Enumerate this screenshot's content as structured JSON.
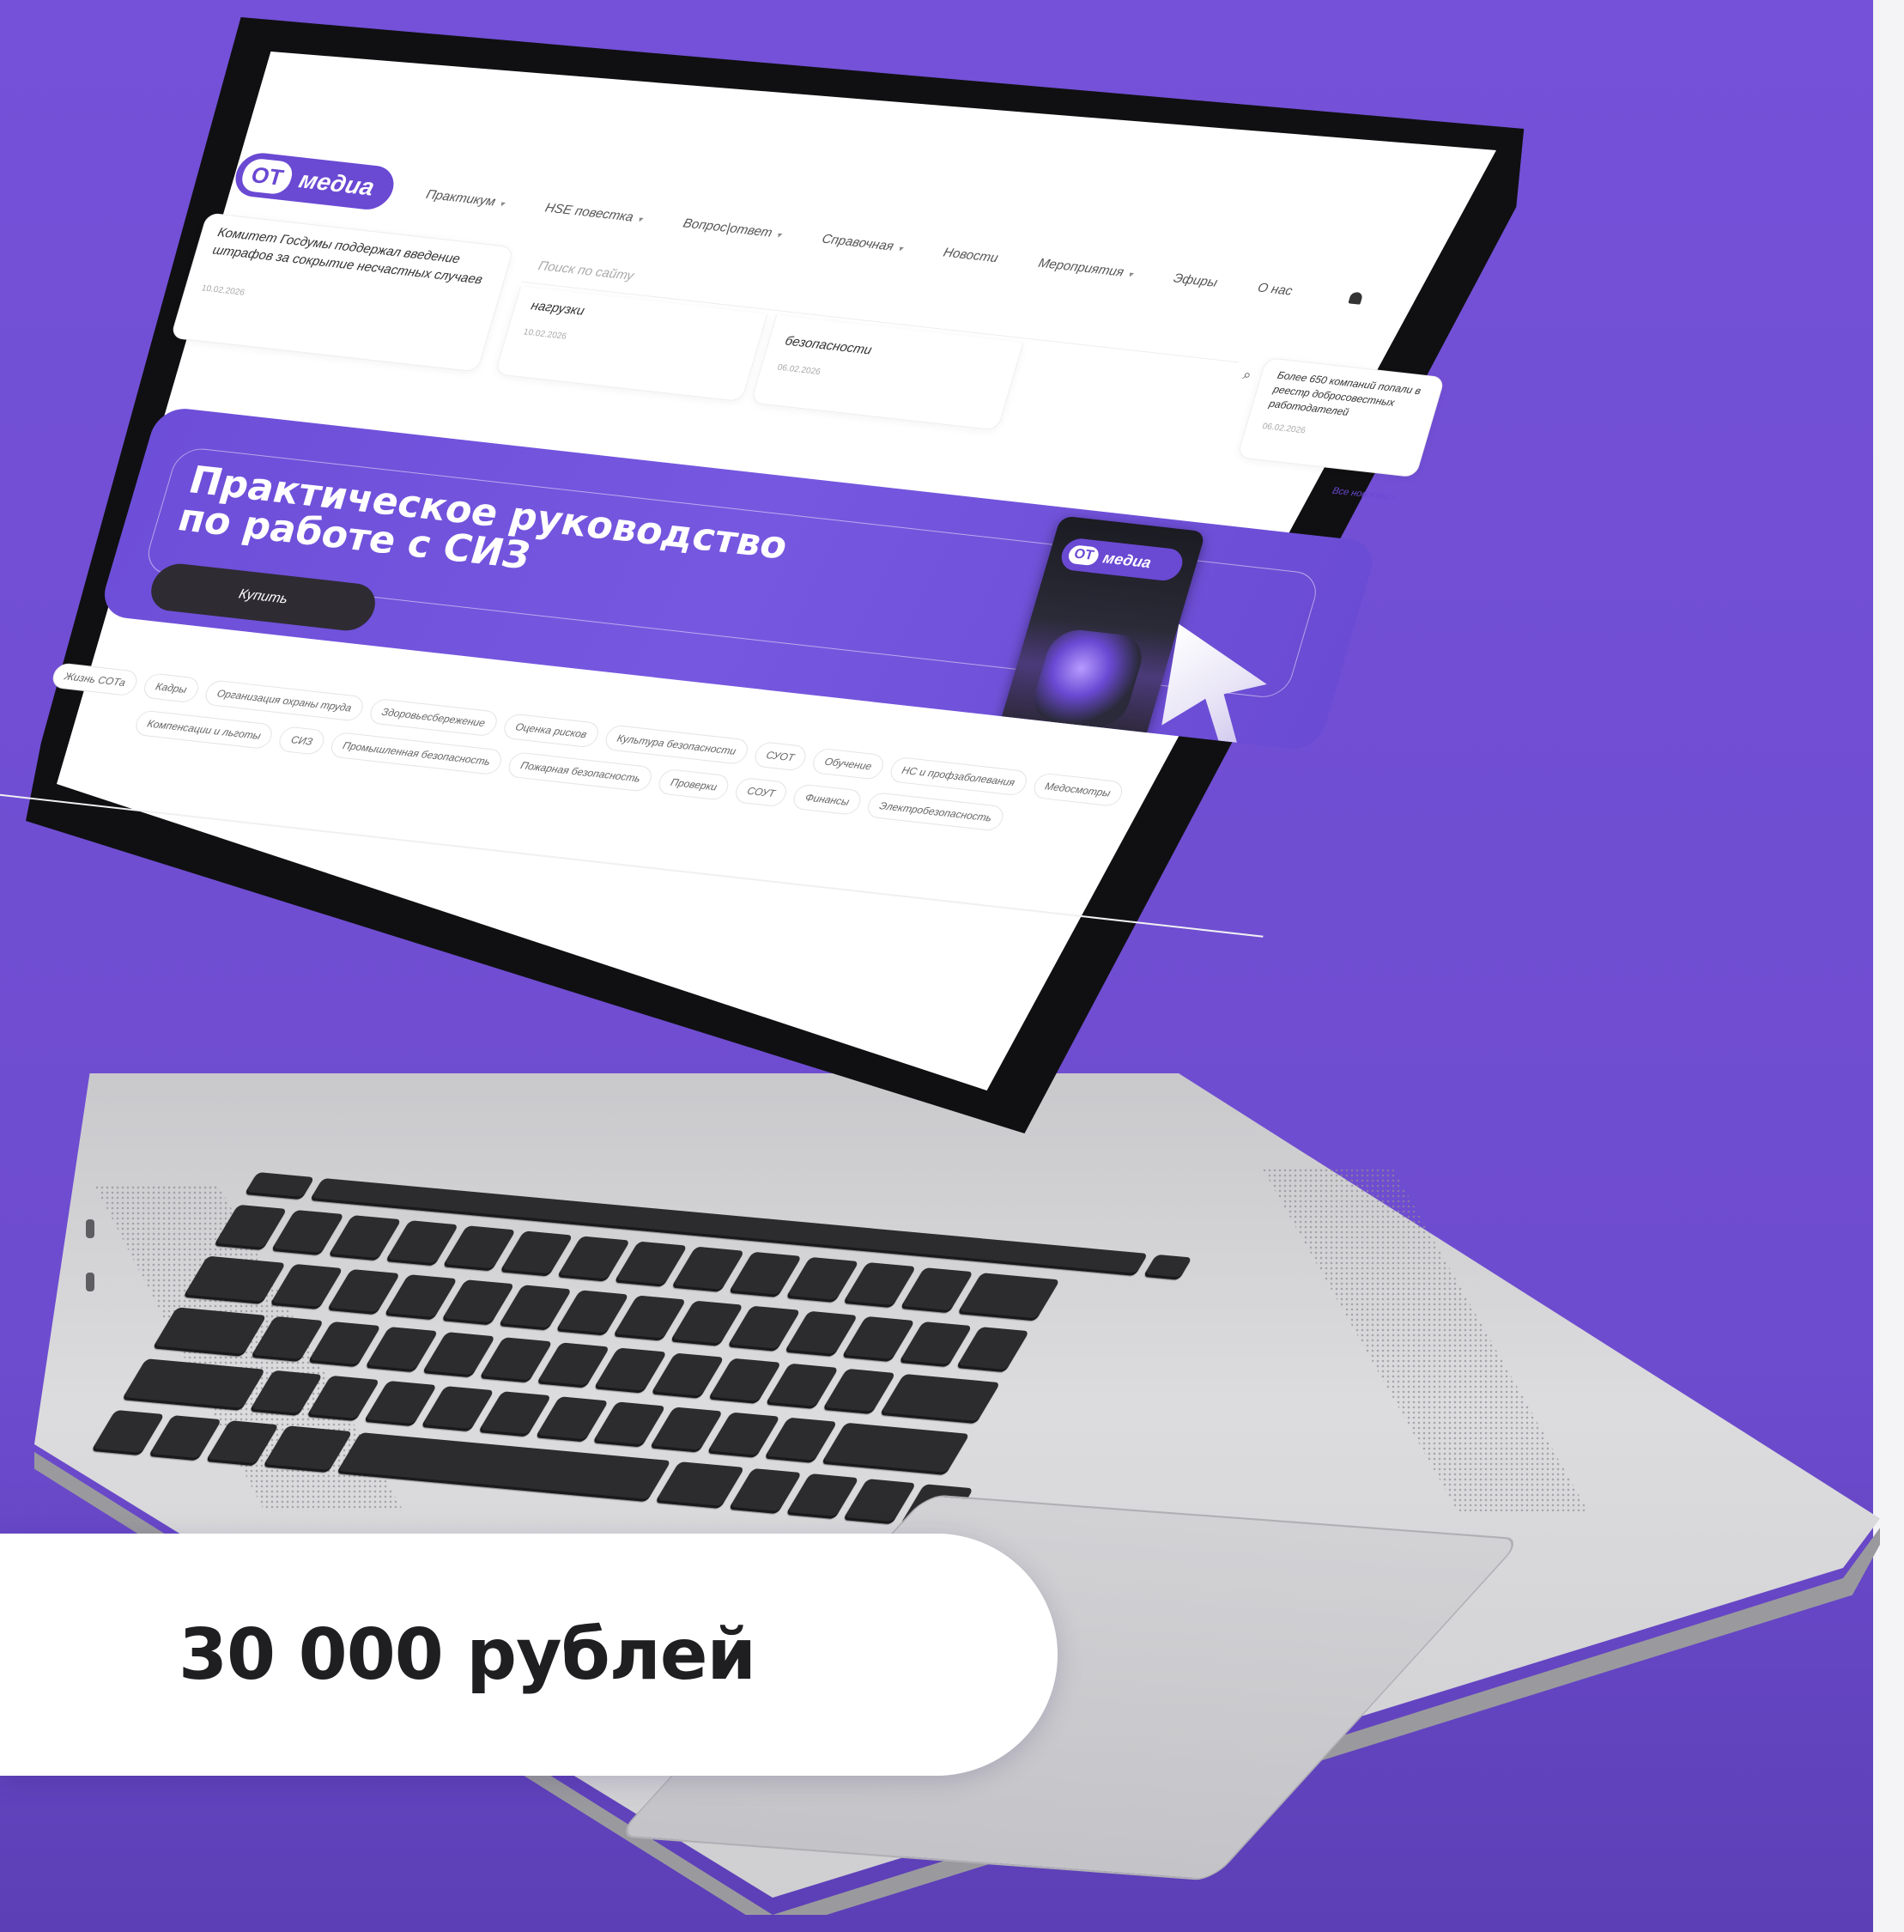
{
  "site": {
    "logo": {
      "ot": "ОТ",
      "media": "медиа"
    },
    "nav": [
      {
        "label": "Практикум",
        "has_dropdown": true
      },
      {
        "label": "HSE повестка",
        "has_dropdown": true
      },
      {
        "label": "Вопрос|ответ",
        "has_dropdown": true
      },
      {
        "label": "Справочная",
        "has_dropdown": true
      },
      {
        "label": "Новости",
        "has_dropdown": false
      },
      {
        "label": "Мероприятия",
        "has_dropdown": true
      },
      {
        "label": "Эфиры",
        "has_dropdown": false
      },
      {
        "label": "О нас",
        "has_dropdown": false
      }
    ],
    "search": {
      "placeholder": "Поиск по сайту"
    },
    "news": [
      {
        "title": "Комитет Госдумы поддержал введение штрафов за сокрытие несчастных случаев",
        "date": "10.02.2026"
      },
      {
        "title": "нагрузки",
        "date": "10.02.2026"
      },
      {
        "title": "безопасности",
        "date": "06.02.2026"
      },
      {
        "title": "Более 650 компаний попали в реестр добросовестных работодателей",
        "date": "06.02.2026"
      }
    ],
    "all_news_label": "Все новости",
    "banner": {
      "title_line1": "Практическое руководство",
      "title_line2": "по работе с СИЗ",
      "buy_label": "Купить"
    },
    "book_logo": {
      "ot": "ОТ",
      "media": "медиа"
    },
    "tags_row1": [
      "Жизнь СОТа",
      "Кадры",
      "Организация охраны труда",
      "Здоровьесбережение",
      "Оценка рисков",
      "Культура безопасности",
      "СУОТ",
      "Обучение",
      "НС и профзаболевания",
      "Медосмотры"
    ],
    "tags_row2": [
      "Компенсации и льготы",
      "СИЗ",
      "Промышленная безопасность",
      "Пожарная безопасность",
      "Проверки",
      "СОУТ",
      "Финансы",
      "Электробезопасность"
    ]
  },
  "price": {
    "label": "30 000 рублей"
  },
  "colors": {
    "background": "#7350d6",
    "accent": "#6a49d3",
    "button_dark": "#2e2b33"
  },
  "icons": {
    "search": "search-icon",
    "user": "user-icon",
    "dropdown": "chevron-down-icon"
  }
}
